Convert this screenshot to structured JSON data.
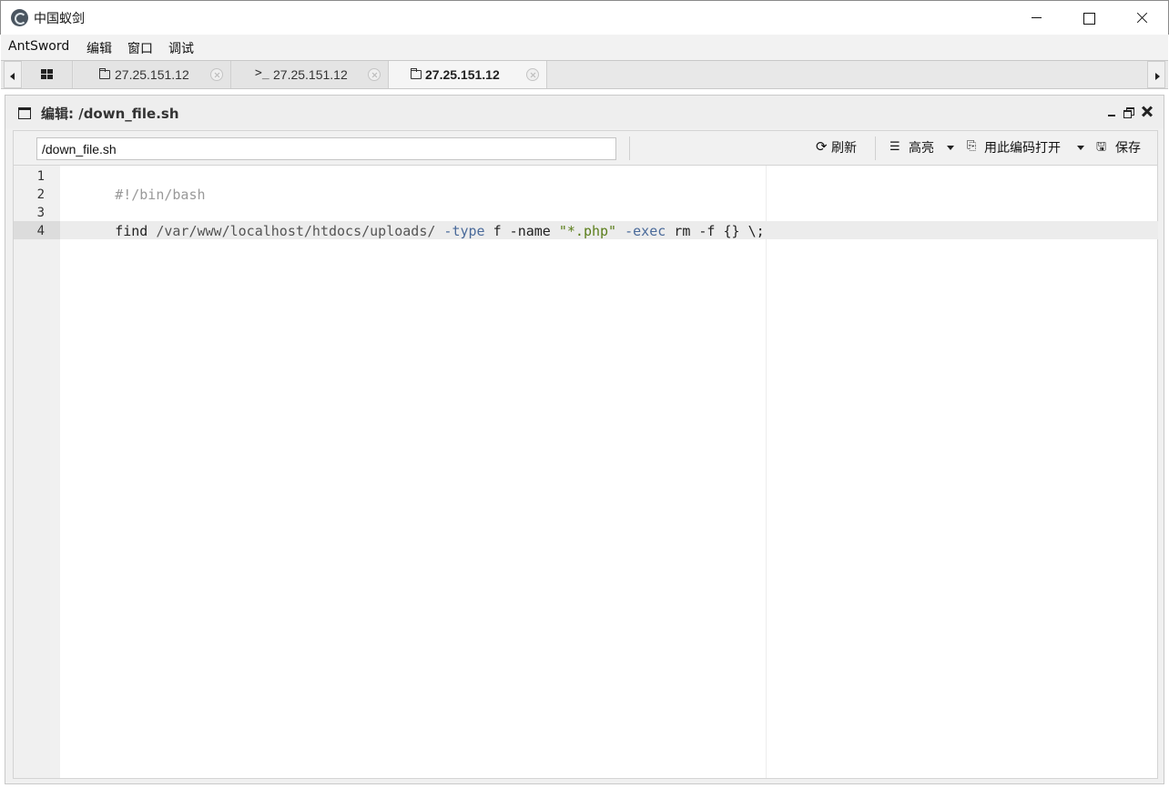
{
  "window": {
    "title": "中国蚁剑"
  },
  "menu": [
    "AntSword",
    "编辑",
    "窗口",
    "调试"
  ],
  "tabs": [
    {
      "label": "27.25.151.12",
      "icon": "folder-icon",
      "active": false
    },
    {
      "label": "27.25.151.12",
      "icon": "terminal-icon",
      "terminal_prefix": ">_",
      "active": false
    },
    {
      "label": "27.25.151.12",
      "icon": "folder-icon",
      "active": true
    }
  ],
  "panel": {
    "title": "编辑: /down_file.sh"
  },
  "toolbar": {
    "path_value": "/down_file.sh",
    "refresh_label": "刷新",
    "highlight_label": "高亮",
    "open_with_encoding_label": "用此编码打开",
    "save_label": "保存"
  },
  "editor": {
    "lines": [
      {
        "no": "1",
        "tokens": [
          {
            "text": "#!/bin/bash",
            "type": "comment"
          }
        ]
      },
      {
        "no": "2",
        "tokens": []
      },
      {
        "no": "3",
        "tokens": [
          {
            "text": "find ",
            "type": "plain"
          },
          {
            "text": "/var/www/localhost/htdocs/uploads/",
            "type": "path"
          },
          {
            "text": " ",
            "type": "plain"
          },
          {
            "text": "-type",
            "type": "flag"
          },
          {
            "text": " f -name ",
            "type": "plain"
          },
          {
            "text": "\"*.php\"",
            "type": "string"
          },
          {
            "text": " ",
            "type": "plain"
          },
          {
            "text": "-exec",
            "type": "flag"
          },
          {
            "text": " rm -f {} \\;",
            "type": "plain"
          }
        ]
      },
      {
        "no": "4",
        "tokens": []
      }
    ],
    "active_line": 4
  }
}
